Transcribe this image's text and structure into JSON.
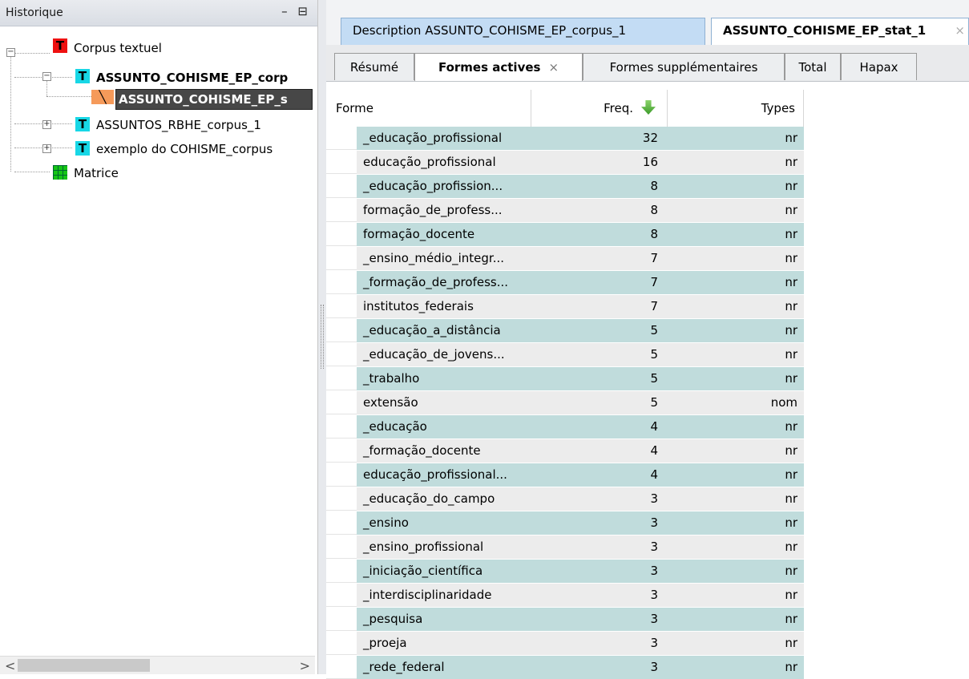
{
  "left_panel": {
    "title": "Historique",
    "controls": "– ⊟",
    "tree": [
      {
        "label": "Corpus textuel",
        "icon": "T"
      },
      {
        "label": "ASSUNTO_COHISME_EP_corp",
        "icon": "T"
      },
      {
        "label": "ASSUNTO_COHISME_EP_s",
        "icon": "stat"
      },
      {
        "label": "ASSUNTOS_RBHE_corpus_1",
        "icon": "T"
      },
      {
        "label": "exemplo do  COHISME_corpus",
        "icon": "T"
      },
      {
        "label": "Matrice",
        "icon": "grid"
      }
    ],
    "scroll_left": "<",
    "scroll_right": ">"
  },
  "editor_tabs": [
    {
      "label": "Description ASSUNTO_COHISME_EP_corpus_1"
    },
    {
      "label": "ASSUNTO_COHISME_EP_stat_1",
      "close": "×"
    }
  ],
  "sub_tabs": [
    "Résumé",
    "Formes actives",
    "Formes supplémentaires",
    "Total",
    "Hapax"
  ],
  "sub_tab_close": "×",
  "table": {
    "headers": {
      "forme": "Forme",
      "freq": "Freq.",
      "types": "Types"
    },
    "rows": [
      {
        "forme": "_educação_profissional",
        "freq": "32",
        "type": "nr"
      },
      {
        "forme": "educação_profissional",
        "freq": "16",
        "type": "nr"
      },
      {
        "forme": "_educação_profission...",
        "freq": "8",
        "type": "nr"
      },
      {
        "forme": "formação_de_profess...",
        "freq": "8",
        "type": "nr"
      },
      {
        "forme": "formação_docente",
        "freq": "8",
        "type": "nr"
      },
      {
        "forme": "_ensino_médio_integr...",
        "freq": "7",
        "type": "nr"
      },
      {
        "forme": "_formação_de_profess...",
        "freq": "7",
        "type": "nr"
      },
      {
        "forme": "institutos_federais",
        "freq": "7",
        "type": "nr"
      },
      {
        "forme": "_educação_a_distância",
        "freq": "5",
        "type": "nr"
      },
      {
        "forme": "_educação_de_jovens...",
        "freq": "5",
        "type": "nr"
      },
      {
        "forme": "_trabalho",
        "freq": "5",
        "type": "nr"
      },
      {
        "forme": "extensão",
        "freq": "5",
        "type": "nom"
      },
      {
        "forme": "_educação",
        "freq": "4",
        "type": "nr"
      },
      {
        "forme": "_formação_docente",
        "freq": "4",
        "type": "nr"
      },
      {
        "forme": "educação_profissional...",
        "freq": "4",
        "type": "nr"
      },
      {
        "forme": "_educação_do_campo",
        "freq": "3",
        "type": "nr"
      },
      {
        "forme": "_ensino",
        "freq": "3",
        "type": "nr"
      },
      {
        "forme": "_ensino_profissional",
        "freq": "3",
        "type": "nr"
      },
      {
        "forme": "_iniciação_científica",
        "freq": "3",
        "type": "nr"
      },
      {
        "forme": "_interdisciplinaridade",
        "freq": "3",
        "type": "nr"
      },
      {
        "forme": "_pesquisa",
        "freq": "3",
        "type": "nr"
      },
      {
        "forme": "_proeja",
        "freq": "3",
        "type": "nr"
      },
      {
        "forme": "_rede_federal",
        "freq": "3",
        "type": "nr"
      }
    ]
  }
}
